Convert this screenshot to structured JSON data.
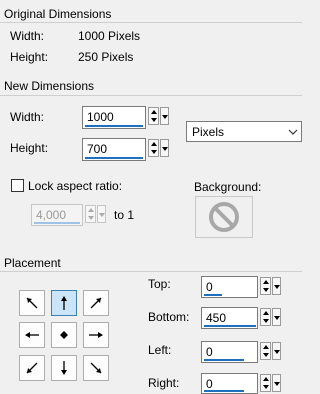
{
  "original": {
    "title": "Original Dimensions",
    "width_label": "Width:",
    "width_value": "1000 Pixels",
    "height_label": "Height:",
    "height_value": "250 Pixels"
  },
  "new": {
    "title": "New Dimensions",
    "width_label": "Width:",
    "width_value": "1000",
    "height_label": "Height:",
    "height_value": "700",
    "units_selected": "Pixels",
    "lock_label": "Lock aspect ratio:",
    "lock_checked": false,
    "ratio_value": "4,000",
    "ratio_suffix": "to 1",
    "background_label": "Background:",
    "background_icon": "no-symbol-icon"
  },
  "placement": {
    "title": "Placement",
    "selected": "top",
    "buttons": [
      "top-left",
      "top",
      "top-right",
      "left",
      "center",
      "right",
      "bottom-left",
      "bottom",
      "bottom-right"
    ],
    "top_label": "Top:",
    "top_value": "0",
    "bottom_label": "Bottom:",
    "bottom_value": "450",
    "left_label": "Left:",
    "left_value": "0",
    "right_label": "Right:",
    "right_value": "0"
  }
}
